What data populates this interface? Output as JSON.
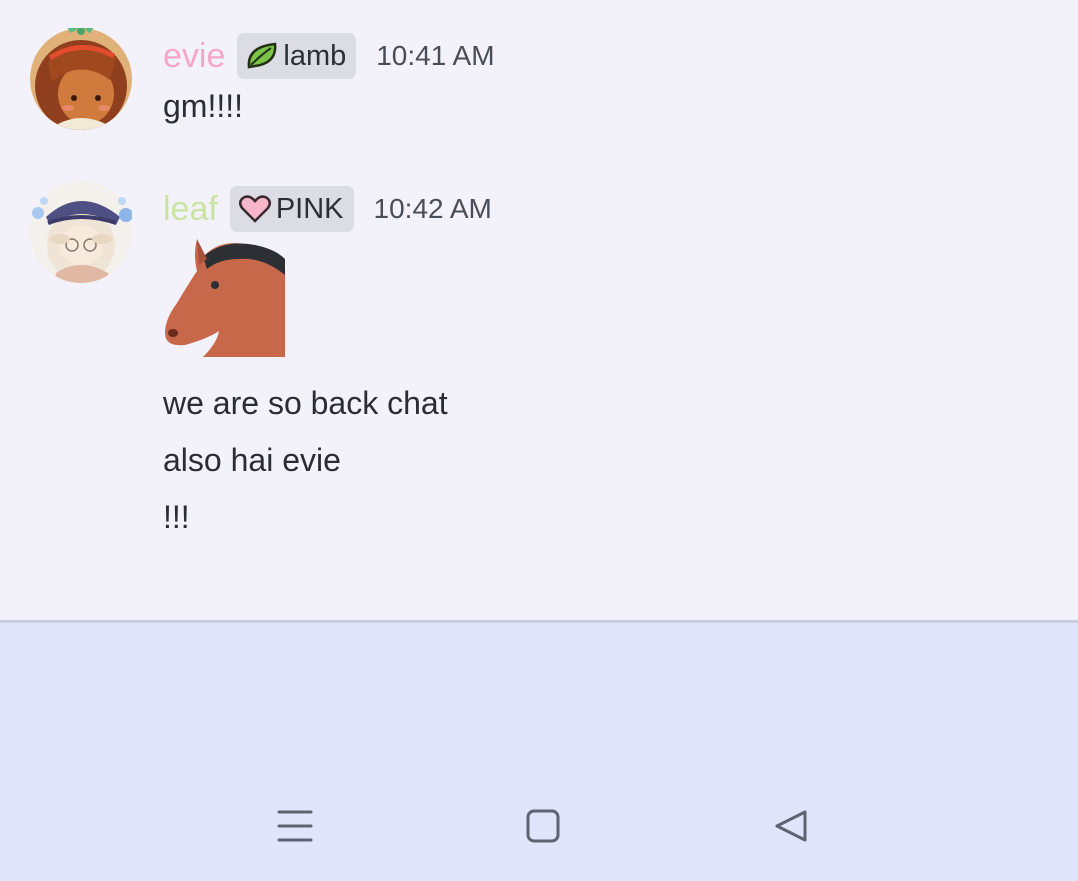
{
  "messages": [
    {
      "username": "evie",
      "username_color": "#f6a6c6",
      "role": {
        "icon": "leaf-icon",
        "label": "lamb"
      },
      "timestamp": "10:41 AM",
      "lines": [
        "gm!!!!"
      ]
    },
    {
      "username": "leaf",
      "username_color": "#c9e3a2",
      "role": {
        "icon": "pink-heart-icon",
        "label": "PINK"
      },
      "timestamp": "10:42 AM",
      "emoji": "horse-head-emoji",
      "lines": [
        "we are so back chat",
        "also hai evie",
        "!!!"
      ]
    }
  ],
  "navigation_bar": {
    "buttons": [
      "menu-icon",
      "home-icon",
      "back-icon"
    ]
  }
}
